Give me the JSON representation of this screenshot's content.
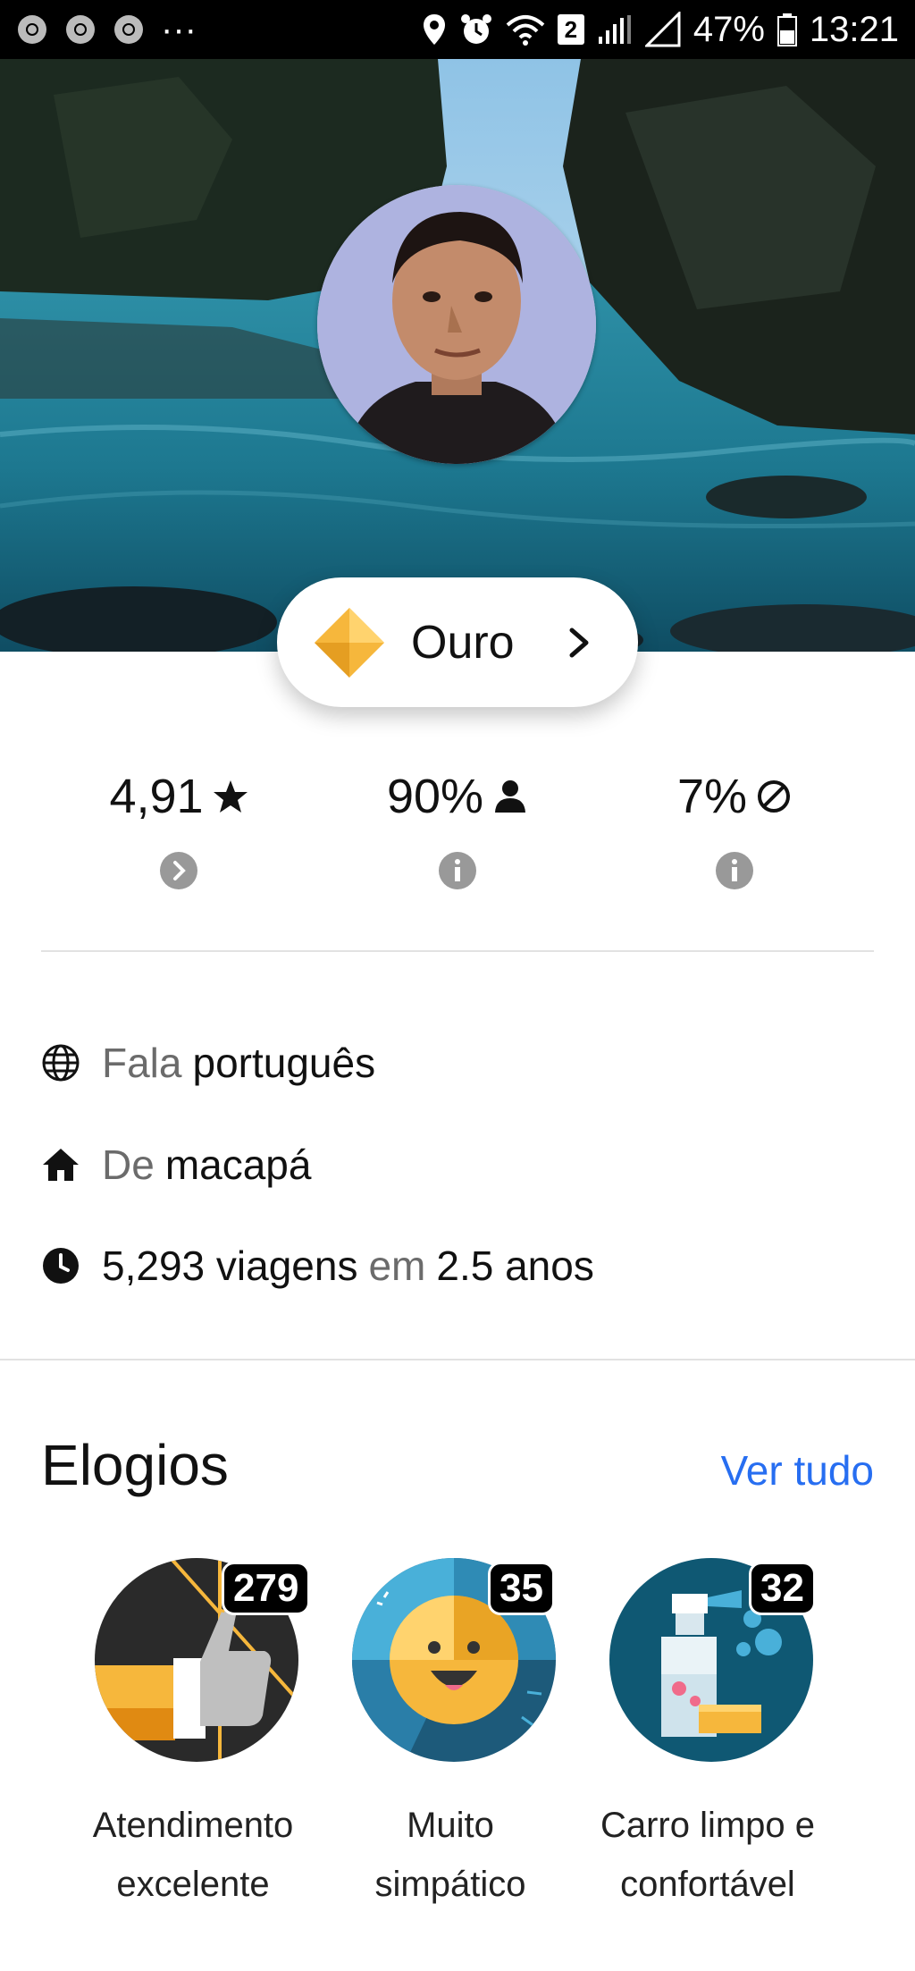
{
  "status_bar": {
    "battery": "47%",
    "time": "13:21",
    "sim_slot": "2",
    "overflow": "···"
  },
  "profile": {
    "tier_label": "Ouro"
  },
  "stats": [
    {
      "value": "4,91",
      "icon": "star-icon",
      "sub_icon": "chevron-circle-icon"
    },
    {
      "value": "90%",
      "icon": "person-icon",
      "sub_icon": "info-icon"
    },
    {
      "value": "7%",
      "icon": "block-icon",
      "sub_icon": "info-icon"
    }
  ],
  "info": {
    "language_prefix": "Fala",
    "language": "português",
    "hometown_prefix": "De",
    "hometown": "macapá",
    "trips": "5,293 viagens",
    "trips_joiner": "em",
    "duration": "2.5 anos"
  },
  "compliments": {
    "title": "Elogios",
    "see_all": "Ver tudo",
    "items": [
      {
        "count": "279",
        "line1": "Atendimento",
        "line2": "excelente",
        "icon": "thumbs-up-icon"
      },
      {
        "count": "35",
        "line1": "Muito",
        "line2": "simpático",
        "icon": "smiley-icon"
      },
      {
        "count": "32",
        "line1": "Carro limpo e",
        "line2": "confortável",
        "icon": "spray-bottle-icon"
      }
    ]
  },
  "colors": {
    "accent_link": "#276ef1",
    "tier_gold": "#f6b73c"
  }
}
